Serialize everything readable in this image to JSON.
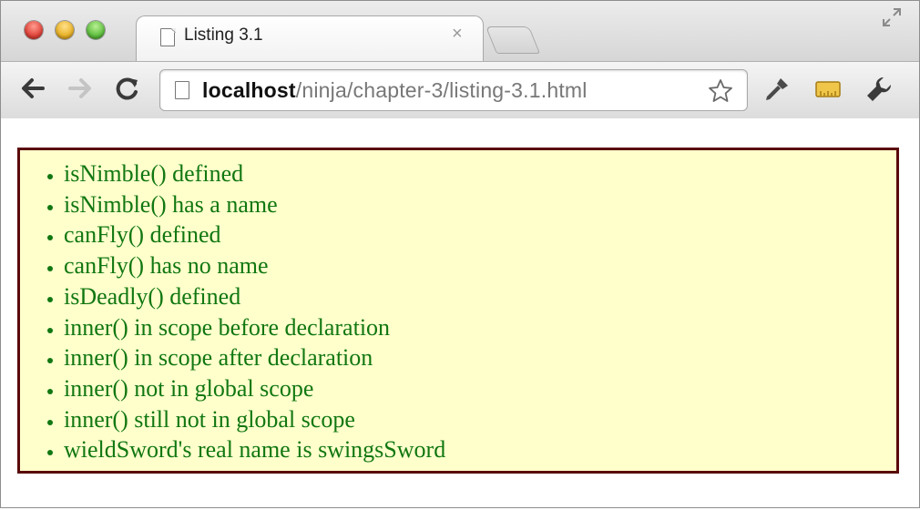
{
  "window": {
    "traffic_lights": [
      "close",
      "minimize",
      "zoom"
    ]
  },
  "tab": {
    "title": "Listing 3.1",
    "close_glyph": "×"
  },
  "toolbar": {
    "url_host": "localhost",
    "url_path": "/ninja/chapter-3/listing-3.1.html"
  },
  "icons": {
    "back": "back-arrow-icon",
    "forward": "forward-arrow-icon",
    "reload": "reload-icon",
    "page": "page-icon",
    "bookmark": "star-icon",
    "extension_1": "pen-icon",
    "extension_2": "ruler-icon",
    "settings": "wrench-icon",
    "fullscreen": "fullscreen-icon"
  },
  "results": {
    "items": [
      "isNimble() defined",
      "isNimble() has a name",
      "canFly() defined",
      "canFly() has no name",
      "isDeadly() defined",
      "inner() in scope before declaration",
      "inner() in scope after declaration",
      "inner() not in global scope",
      "inner() still not in global scope",
      "wieldSword's real name is swingsSword"
    ]
  },
  "colors": {
    "result_text": "#117711",
    "result_background": "#ffffcc",
    "result_border": "#5a0a0a"
  }
}
